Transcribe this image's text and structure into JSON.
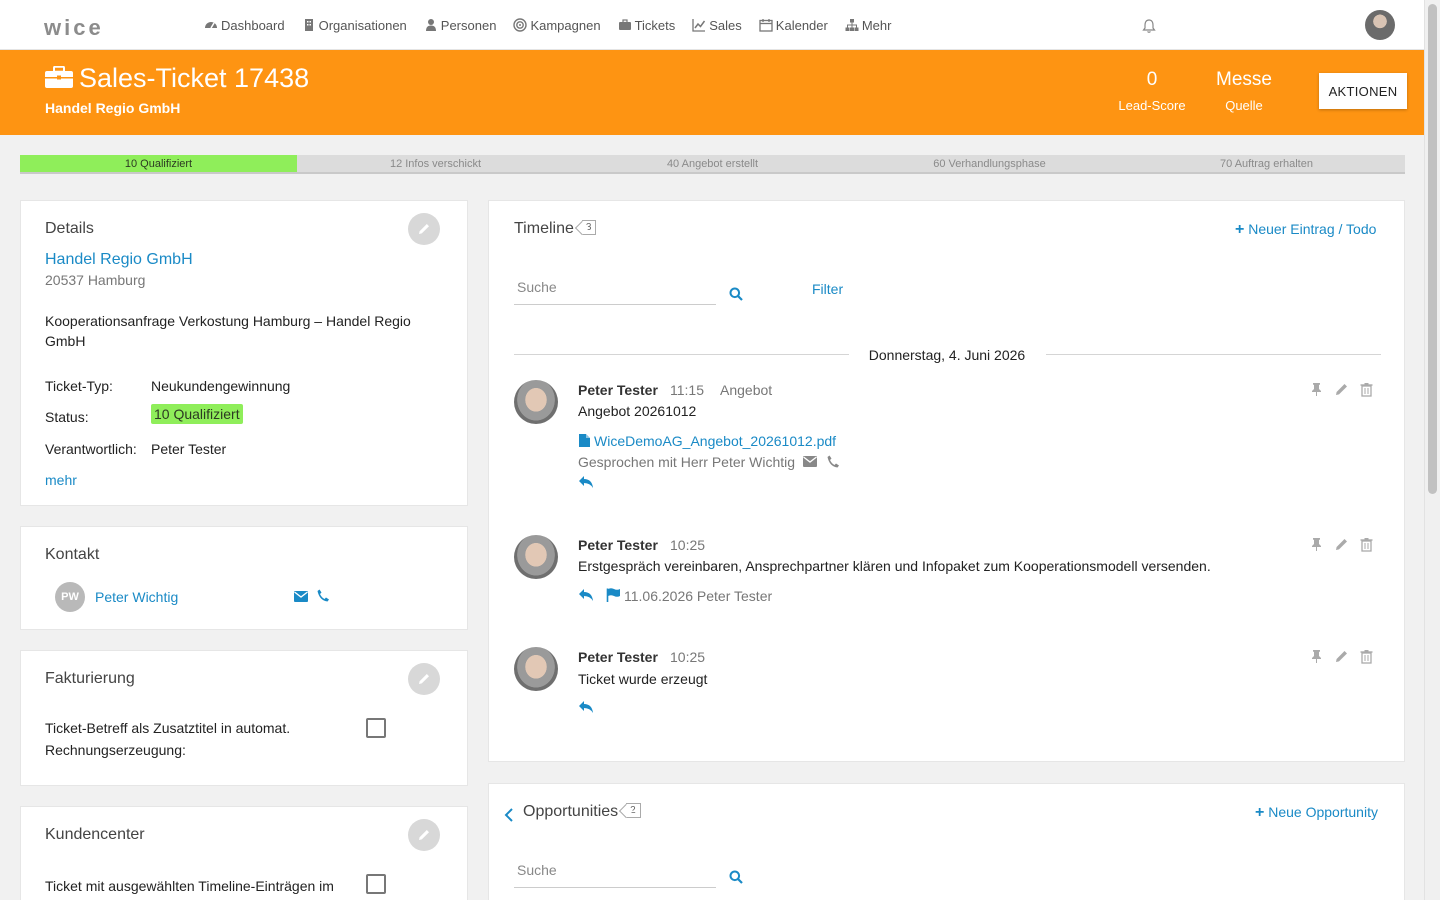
{
  "nav": {
    "logo": "wice",
    "items": [
      {
        "label": "Dashboard",
        "icon": "dashboard-icon"
      },
      {
        "label": "Organisationen",
        "icon": "building-icon"
      },
      {
        "label": "Personen",
        "icon": "user-icon"
      },
      {
        "label": "Kampagnen",
        "icon": "target-icon"
      },
      {
        "label": "Tickets",
        "icon": "briefcase-icon"
      },
      {
        "label": "Sales",
        "icon": "chart-line-icon"
      },
      {
        "label": "Kalender",
        "icon": "calendar-icon"
      },
      {
        "label": "Mehr",
        "icon": "sitemap-icon"
      }
    ]
  },
  "header": {
    "title": "Sales-Ticket 17438",
    "subtitle": "Handel Regio GmbH",
    "lead_score_value": "0",
    "lead_score_label": "Lead-Score",
    "source_value": "Messe",
    "source_label": "Quelle",
    "actions_label": "AKTIONEN",
    "background_color": "#fe9412"
  },
  "pipeline": {
    "stages": [
      "10 Qualifiziert",
      "12 Infos verschickt",
      "40 Angebot erstellt",
      "60 Verhandlungsphase",
      "70 Auftrag erhalten"
    ],
    "active_index": 0,
    "active_color": "#8fee5a"
  },
  "details": {
    "heading": "Details",
    "company": "Handel Regio GmbH",
    "address": "20537 Hamburg",
    "description": "Kooperationsanfrage Verkostung Hamburg – Handel Regio GmbH",
    "ticket_type_label": "Ticket-Typ:",
    "ticket_type_value": "Neukundengewinnung",
    "status_label": "Status:",
    "status_value": "10 Qualifiziert",
    "owner_label": "Verantwortlich:",
    "owner_value": "Peter Tester",
    "more_link": "mehr"
  },
  "contact": {
    "heading": "Kontakt",
    "initials": "PW",
    "name": "Peter Wichtig"
  },
  "billing": {
    "heading": "Fakturierung",
    "checkbox_label": "Ticket-Betreff als Zusatztitel in automat. Rechnungserzeugung:",
    "checked": false
  },
  "customer_center": {
    "heading": "Kundencenter",
    "checkbox_label": "Ticket mit ausgewählten Timeline-Einträgen im",
    "checked": false
  },
  "timeline": {
    "heading": "Timeline",
    "count": "3",
    "new_entry": "Neuer Eintrag / Todo",
    "search_placeholder": "Suche",
    "filter_label": "Filter",
    "date_divider": "Donnerstag, 4. Juni 2026",
    "entries": [
      {
        "author": "Peter Tester",
        "time": "11:15",
        "type": "Angebot",
        "text": "Angebot 20261012",
        "attachment": "WiceDemoAG_Angebot_20261012.pdf",
        "spoken_with": "Gesprochen mit Herr Peter Wichtig"
      },
      {
        "author": "Peter Tester",
        "time": "10:25",
        "text": "Erstgespräch vereinbaren, Ansprechpartner klären und Infopaket zum Kooperationsmodell versenden.",
        "todo": "11.06.2026 Peter Tester"
      },
      {
        "author": "Peter Tester",
        "time": "10:25",
        "text": "Ticket wurde erzeugt"
      }
    ]
  },
  "opportunities": {
    "heading": "Opportunities",
    "count": "2",
    "new_label": "Neue Opportunity",
    "search_placeholder": "Suche"
  }
}
